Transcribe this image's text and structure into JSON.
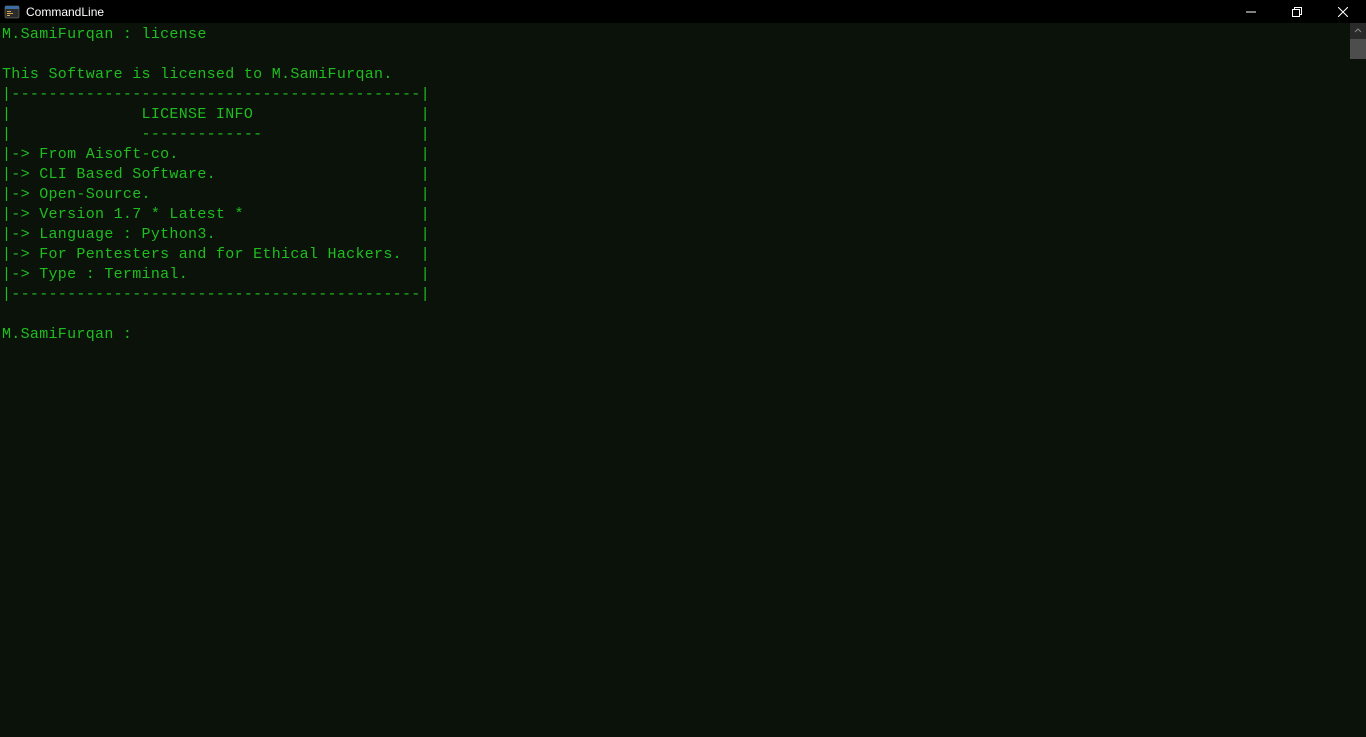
{
  "window": {
    "title": "CommandLine"
  },
  "terminal": {
    "prompt_line": "M.SamiFurqan : license",
    "blank1": "",
    "license_header": "This Software is licensed to M.SamiFurqan.",
    "box_top": "|--------------------------------------------|",
    "box_title": "|              LICENSE INFO                  |",
    "box_under": "|              -------------                 |",
    "box_l1": "|-> From Aisoft-co.                          |",
    "box_l2": "|-> CLI Based Software.                      |",
    "box_l3": "|-> Open-Source.                             |",
    "box_l4": "|-> Version 1.7 * Latest *                   |",
    "box_l5": "|-> Language : Python3.                      |",
    "box_l6": "|-> For Pentesters and for Ethical Hackers.  |",
    "box_l7": "|-> Type : Terminal.                         |",
    "box_bottom": "|--------------------------------------------|",
    "blank2": "",
    "prompt_waiting": "M.SamiFurqan : "
  },
  "colors": {
    "terminal_bg": "#0a120a",
    "terminal_fg": "#1fbd1f",
    "titlebar_bg": "#000000"
  }
}
